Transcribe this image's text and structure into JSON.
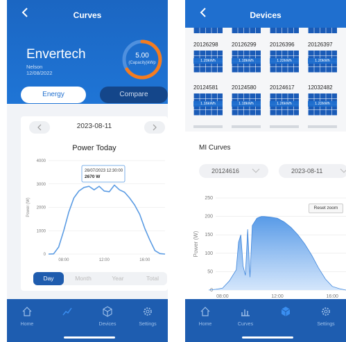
{
  "left": {
    "nav_title": "Curves",
    "plant_name": "Envertech",
    "location": "Nelson",
    "date": "12/08/2022",
    "capacity_value": "5.00",
    "capacity_label": "(Capacity)kWp",
    "segments": [
      "Energy",
      "Compare"
    ],
    "selected_date": "2023-08-11",
    "chart_title": "Power Today",
    "tabs": [
      "Day",
      "Month",
      "Year",
      "Total"
    ],
    "tabbar": [
      "Home",
      "",
      "Devices",
      "Settings"
    ]
  },
  "right": {
    "nav_title": "Devices",
    "devices_row1": [
      {
        "id": "20126298",
        "kwh": "1.20kWh"
      },
      {
        "id": "20126299",
        "kwh": "1.18kWh"
      },
      {
        "id": "20126396",
        "kwh": "1.22kWh"
      },
      {
        "id": "20126397",
        "kwh": "1.20kWh"
      }
    ],
    "devices_row2": [
      {
        "id": "20124581",
        "kwh": "1.16kWh"
      },
      {
        "id": "20124580",
        "kwh": "1.18kWh"
      },
      {
        "id": "20124617",
        "kwh": "1.26kWh"
      },
      {
        "id": "12032482",
        "kwh": "1.22kWh"
      }
    ],
    "mi_title": "MI Curves",
    "selected_device": "20124616",
    "selected_date": "2023-08-11",
    "reset_zoom": "Reset zoom",
    "tabbar": [
      "Home",
      "Curves",
      "",
      "Settings"
    ]
  },
  "chart_data": [
    {
      "type": "line",
      "title": "Power Today",
      "ylabel": "Power (W)",
      "ylim": [
        0,
        4000
      ],
      "yticks": [
        0,
        1000,
        2000,
        3000,
        4000
      ],
      "xticks": [
        "08:00",
        "12:00",
        "16:00"
      ],
      "tooltip": {
        "time": "26/07/2023 12:30:00",
        "value": "2670 W"
      },
      "x": [
        "06:30",
        "07:00",
        "07:30",
        "08:00",
        "08:30",
        "09:00",
        "09:30",
        "10:00",
        "10:30",
        "11:00",
        "11:30",
        "12:00",
        "12:30",
        "13:00",
        "13:30",
        "14:00",
        "14:30",
        "15:00",
        "15:30",
        "16:00",
        "16:30",
        "17:00",
        "17:30",
        "18:00"
      ],
      "values": [
        0,
        10,
        300,
        1000,
        1800,
        2400,
        2700,
        2850,
        2900,
        2750,
        2900,
        2700,
        2670,
        2950,
        2750,
        2650,
        2400,
        2100,
        1700,
        1100,
        600,
        150,
        20,
        0
      ]
    },
    {
      "type": "area",
      "ylabel": "Power (W)",
      "ylim": [
        0,
        250
      ],
      "yticks": [
        0,
        50,
        100,
        150,
        200,
        250
      ],
      "xticks": [
        "08:00",
        "12:00",
        "16:00"
      ],
      "x": [
        "07:00",
        "07:30",
        "08:00",
        "08:30",
        "09:00",
        "09:10",
        "09:20",
        "09:30",
        "09:40",
        "09:50",
        "10:00",
        "10:10",
        "10:20",
        "10:30",
        "10:40",
        "10:50",
        "11:00",
        "11:30",
        "12:00",
        "12:30",
        "13:00",
        "13:30",
        "14:00",
        "14:30",
        "15:00",
        "15:30",
        "16:00",
        "16:30",
        "17:00"
      ],
      "values": [
        0,
        2,
        5,
        25,
        55,
        130,
        150,
        65,
        40,
        165,
        35,
        175,
        185,
        195,
        198,
        200,
        200,
        198,
        195,
        185,
        170,
        150,
        125,
        95,
        60,
        30,
        10,
        4,
        0
      ]
    }
  ]
}
